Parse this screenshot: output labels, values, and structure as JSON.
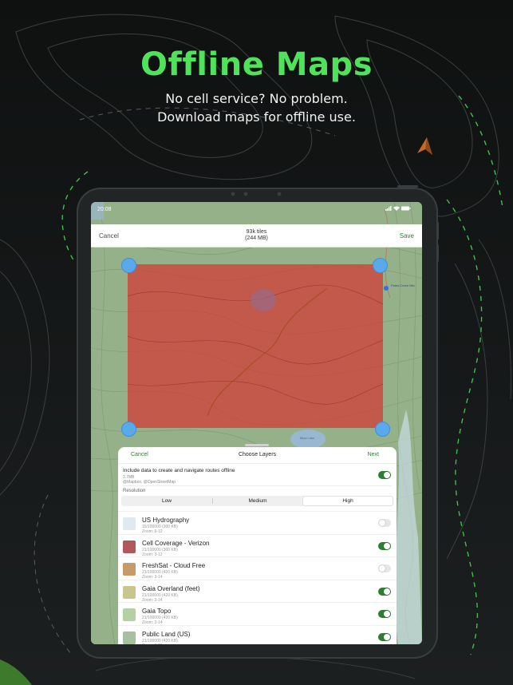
{
  "promo": {
    "title": "Offline Maps",
    "subtitle_line1": "No cell service? No problem.",
    "subtitle_line2": "Download maps for offline use."
  },
  "status_bar": {
    "time": "20:08",
    "icons": "signal-wifi-battery"
  },
  "top_bar": {
    "cancel_label": "Cancel",
    "tiles_count": "93k tiles",
    "tiles_size": "(244 MB)",
    "save_label": "Save"
  },
  "selection": {
    "color": "#d63832"
  },
  "sheet": {
    "cancel_label": "Cancel",
    "title": "Choose Layers",
    "next_label": "Next",
    "route_data": {
      "label": "Include data to create and navigate routes offline",
      "size": "3.7MB",
      "credit": "@Mapbox, @OpenStreetMap",
      "enabled": true
    },
    "resolution_label": "Resolution",
    "resolution_options": [
      "Low",
      "Medium",
      "High"
    ],
    "resolution_selected": "High",
    "layers": [
      {
        "name": "US Hydrography",
        "size": "15/100000 (300 KB)",
        "zoom": "Zoom: 6-12",
        "enabled": false,
        "thumb": "hydro-thumb",
        "color": "#dfe9f0"
      },
      {
        "name": "Cell Coverage - Verizon",
        "size": "21/100000 (300 KB)",
        "zoom": "Zoom: 3-12",
        "enabled": true,
        "thumb": "coverage-thumb",
        "color": "#b3585a"
      },
      {
        "name": "FreshSat - Cloud Free",
        "size": "21/100000 (420 KB)",
        "zoom": "Zoom: 3-14",
        "enabled": false,
        "thumb": "satellite-thumb",
        "color": "#c89a6a"
      },
      {
        "name": "Gaia Overland (feet)",
        "size": "21/100000 (420 KB)",
        "zoom": "Zoom: 3-14",
        "enabled": true,
        "thumb": "overland-thumb",
        "color": "#c9c58e"
      },
      {
        "name": "Gaia Topo",
        "size": "21/100000 (420 KB)",
        "zoom": "Zoom: 3-14",
        "enabled": true,
        "thumb": "topo-thumb",
        "color": "#b7cfa4"
      },
      {
        "name": "Public Land (US)",
        "size": "21/100000 (420 KB)",
        "zoom": "Zoom: 0-21",
        "enabled": true,
        "thumb": "public-land-thumb",
        "color": "#a8c0a0"
      }
    ]
  },
  "map_labels": {
    "lake": "Mica Lake",
    "peak_label": "Parks Creek Mtn"
  }
}
